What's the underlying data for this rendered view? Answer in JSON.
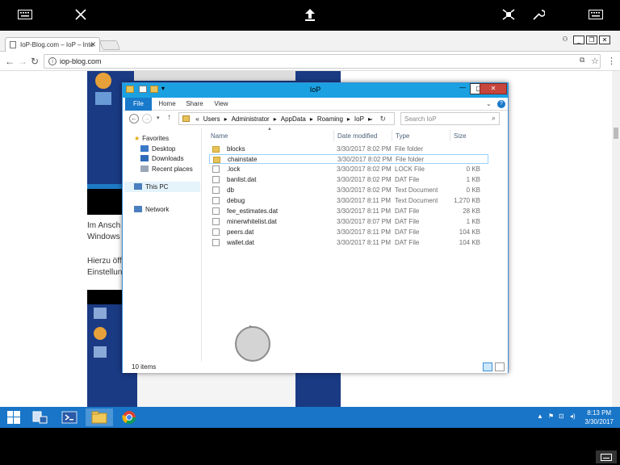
{
  "browser": {
    "tab_title": "IoP-Blog.com – IoP – Inte",
    "url": "iop-blog.com"
  },
  "page": {
    "text_lines": [
      "Im Ansch",
      "Windows",
      "Hierzu öff",
      "Einstellun"
    ]
  },
  "explorer": {
    "title": "IoP",
    "ribbon_tabs": [
      "File",
      "Home",
      "Share",
      "View"
    ],
    "breadcrumb": [
      "«",
      "Users",
      "▸",
      "Administrator",
      "▸",
      "AppData",
      "▸",
      "Roaming",
      "▸",
      "IoP",
      "▸"
    ],
    "search_placeholder": "Search IoP",
    "nav": {
      "favorites": "Favorites",
      "desktop": "Desktop",
      "downloads": "Downloads",
      "recent": "Recent places",
      "this_pc": "This PC",
      "network": "Network"
    },
    "columns": {
      "name": "Name",
      "date": "Date modified",
      "type": "Type",
      "size": "Size"
    },
    "files": [
      {
        "name": "blocks",
        "date": "3/30/2017 8:02 PM",
        "type": "File folder",
        "size": ""
      },
      {
        "name": "chainstate",
        "date": "3/30/2017 8:02 PM",
        "type": "File folder",
        "size": ""
      },
      {
        "name": ".lock",
        "date": "3/30/2017 8:02 PM",
        "type": "LOCK File",
        "size": "0 KB"
      },
      {
        "name": "banlist.dat",
        "date": "3/30/2017 8:02 PM",
        "type": "DAT File",
        "size": "1 KB"
      },
      {
        "name": "db",
        "date": "3/30/2017 8:02 PM",
        "type": "Text Document",
        "size": "0 KB"
      },
      {
        "name": "debug",
        "date": "3/30/2017 8:11 PM",
        "type": "Text Document",
        "size": "1,270 KB"
      },
      {
        "name": "fee_estimates.dat",
        "date": "3/30/2017 8:11 PM",
        "type": "DAT File",
        "size": "28 KB"
      },
      {
        "name": "minerwhitelist.dat",
        "date": "3/30/2017 8:07 PM",
        "type": "DAT File",
        "size": "1 KB"
      },
      {
        "name": "peers.dat",
        "date": "3/30/2017 8:11 PM",
        "type": "DAT File",
        "size": "104 KB"
      },
      {
        "name": "wallet.dat",
        "date": "3/30/2017 8:11 PM",
        "type": "DAT File",
        "size": "104 KB"
      }
    ],
    "status": "10 items"
  },
  "taskbar": {
    "time": "8:13 PM",
    "date": "3/30/2017"
  },
  "colors": {
    "titlebar": "#1ba1e2",
    "taskbar": "#1875c7",
    "file_tab": "#1979ca",
    "close": "#c7453b"
  }
}
